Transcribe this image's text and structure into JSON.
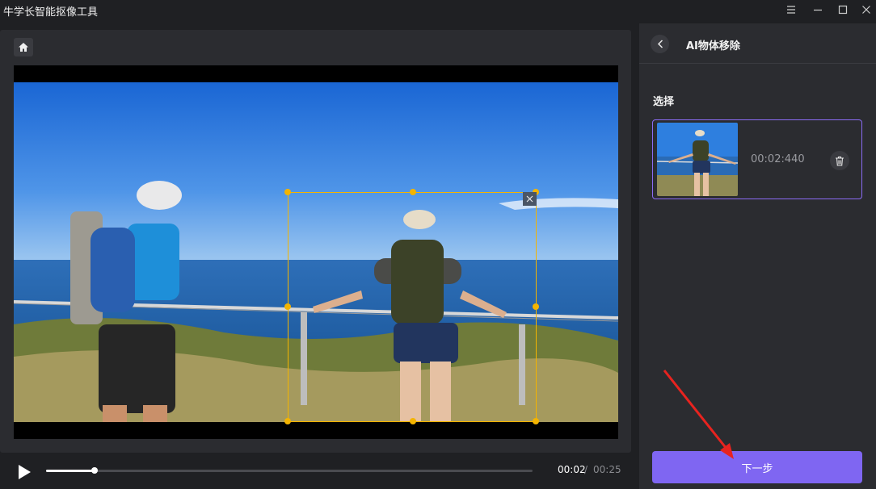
{
  "app": {
    "title": "牛学长智能抠像工具"
  },
  "window_controls": [
    "menu-icon",
    "minimize-icon",
    "maximize-icon",
    "close-icon"
  ],
  "player": {
    "current_time": "00:02",
    "separator": "/",
    "total_time": "00:25",
    "progress": 0.1
  },
  "side_panel": {
    "title": "AI物体移除",
    "section_label": "选择",
    "clip": {
      "timestamp": "00:02:440"
    },
    "next_button": "下一步"
  },
  "colors": {
    "accent": "#7f66f2",
    "selection": "#f4b400",
    "background": "#1f2023",
    "panel": "#2b2c30"
  }
}
